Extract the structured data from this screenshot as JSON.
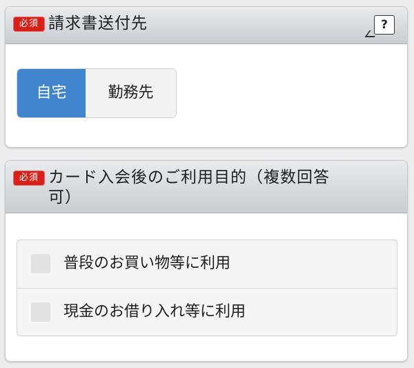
{
  "section1": {
    "badge": "必須",
    "title": "請求書送付先",
    "help_label": "?",
    "options": [
      {
        "label": "自宅",
        "selected": true
      },
      {
        "label": "勤務先",
        "selected": false
      }
    ]
  },
  "section2": {
    "badge": "必須",
    "title": "カード入会後のご利用目的（複数回答可）",
    "options": [
      {
        "label": "普段のお買い物等に利用",
        "checked": false
      },
      {
        "label": "現金のお借り入れ等に利用",
        "checked": false
      }
    ]
  },
  "colors": {
    "required_badge": "#d6201a",
    "selected_toggle": "#3f84cd"
  }
}
